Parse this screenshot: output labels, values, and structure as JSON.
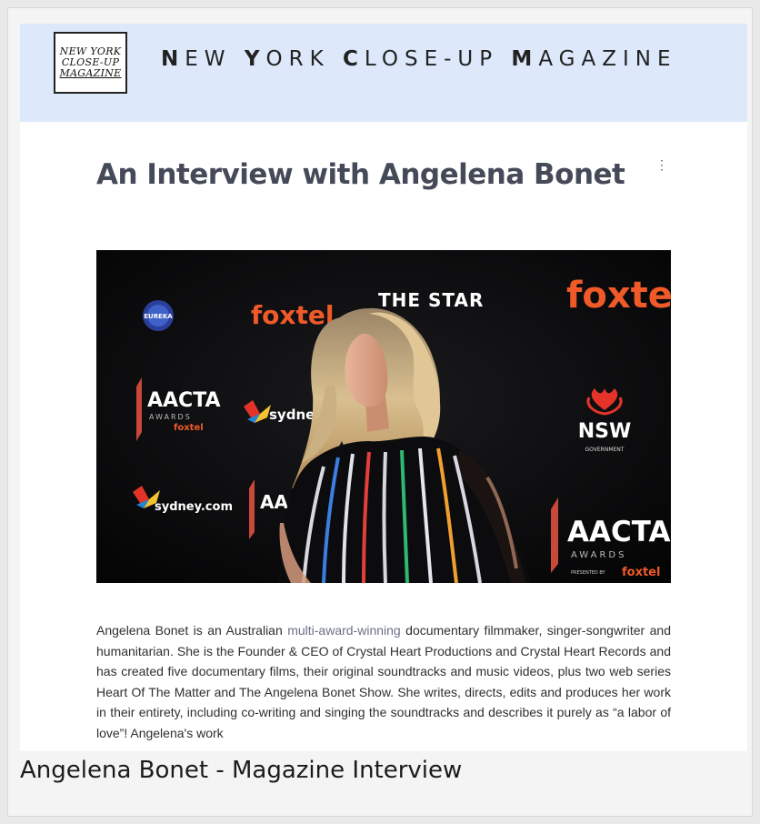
{
  "logo": {
    "line1": "NEW YORK",
    "line2": "CLOSE-UP",
    "line3": "MAGAZINE"
  },
  "masthead": {
    "words": [
      {
        "first": "N",
        "rest": "EW "
      },
      {
        "first": "Y",
        "rest": "ORK "
      },
      {
        "first": "C",
        "rest": "LOSE-UP "
      },
      {
        "first": "M",
        "rest": "AGAZINE"
      }
    ]
  },
  "article": {
    "title": "An Interview with Angelena Bonet",
    "menu_icon": "more-vertical-icon"
  },
  "photo": {
    "logos": {
      "eureka": "EUREKA",
      "foxtel": "foxtel",
      "the_star": "THE STAR",
      "aacta": "AACTA",
      "awards": "AWARDS",
      "presented_by": "PRESENTED BY",
      "sydney_com": "sydney.com",
      "nsw": "NSW",
      "government": "GOVERNMENT"
    }
  },
  "body": {
    "part1": "Angelena Bonet is an Australian ",
    "link": "multi-award-winning",
    "part2": " documentary filmmaker, singer-songwriter and humanitarian. She is the Founder & CEO of Crystal Heart Productions and Crystal Heart Records and has created five documentary films, their original soundtracks and music videos, plus two web series Heart Of The Matter and The Angelena Bonet Show. She writes, directs, edits and produces her work in their entirety, including co-writing and singing the soundtracks and describes it purely as “a labor of love”! Angelena's work"
  },
  "caption": "Angelena Bonet - Magazine Interview",
  "colors": {
    "masthead_bg": "#dde9fb",
    "title_color": "#454a58",
    "foxtel_orange": "#f05a28",
    "nsw_red": "#e4342a"
  }
}
